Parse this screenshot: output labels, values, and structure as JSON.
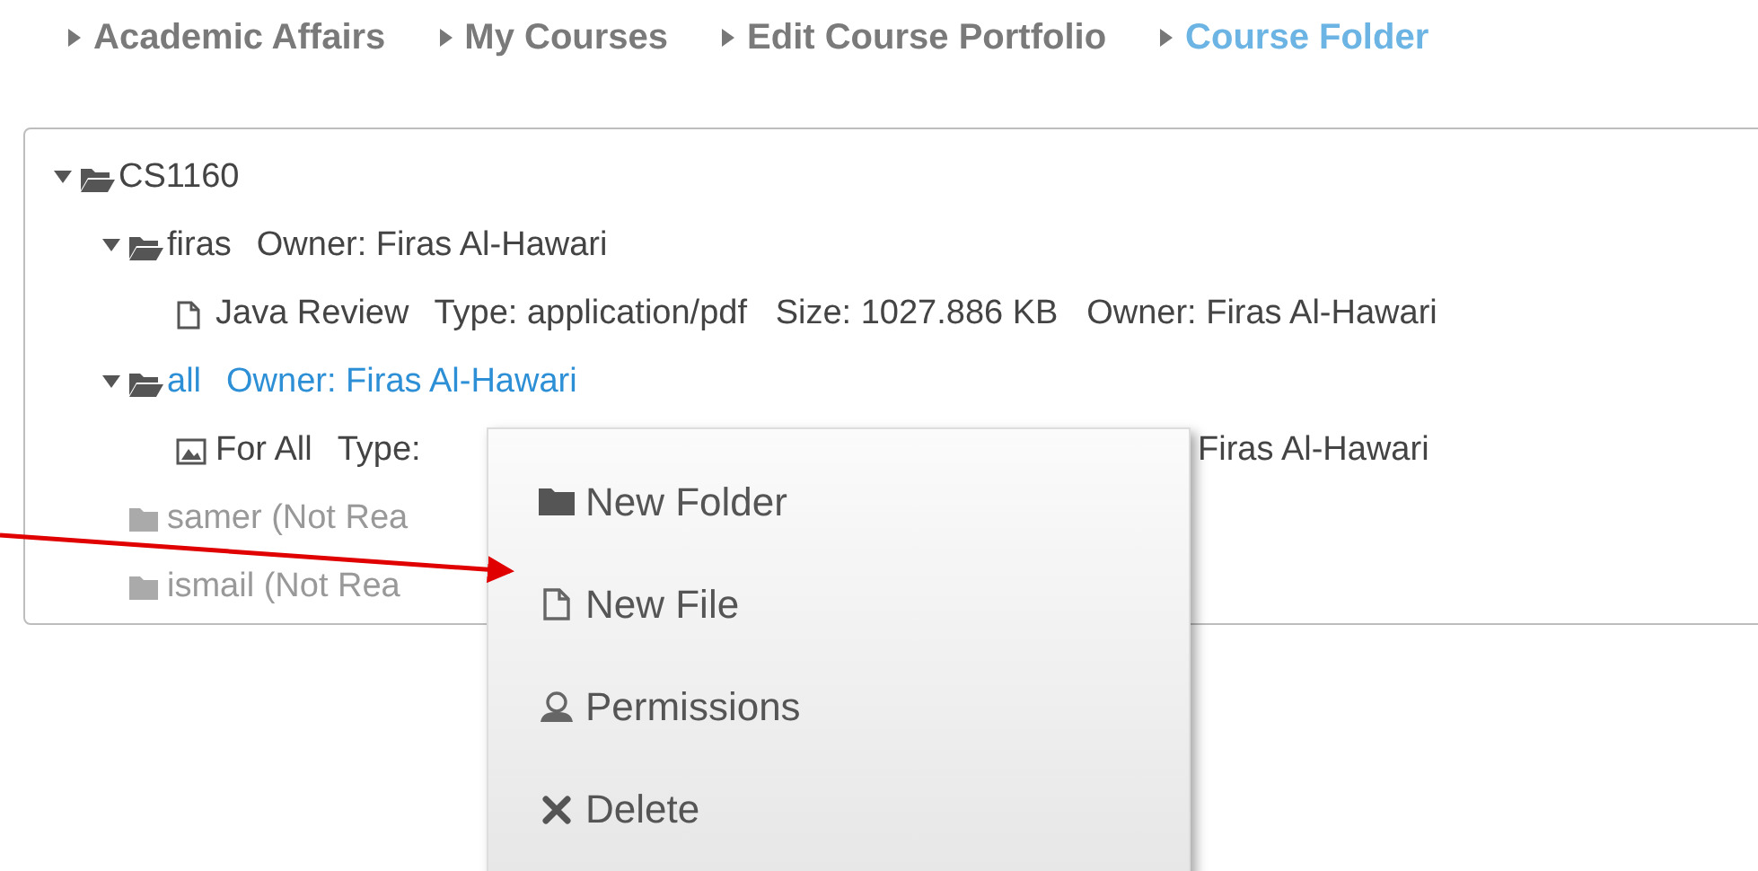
{
  "breadcrumb": [
    {
      "label": "Academic Affairs",
      "selected": false
    },
    {
      "label": "My Courses",
      "selected": false
    },
    {
      "label": "Edit Course Portfolio",
      "selected": false
    },
    {
      "label": "Course Folder",
      "selected": true
    }
  ],
  "tree": {
    "name": "CS1160",
    "kind": "folder",
    "expanded": true,
    "selected": false,
    "disabled": false,
    "children": [
      {
        "name": "firas",
        "kind": "folder",
        "expanded": true,
        "selected": false,
        "disabled": false,
        "details": "Owner: Firas Al-Hawari",
        "children": [
          {
            "name": "Java Review",
            "kind": "file",
            "selected": false,
            "disabled": false,
            "details": "Type: application/pdf   Size: 1027.886 KB   Owner: Firas Al-Hawari"
          }
        ]
      },
      {
        "name": "all",
        "kind": "folder",
        "expanded": true,
        "selected": true,
        "disabled": false,
        "details": "Owner: Firas Al-Hawari",
        "children": [
          {
            "name": "For All",
            "kind": "image",
            "selected": false,
            "disabled": false,
            "details": "Type:",
            "tail": "Firas Al-Hawari"
          }
        ]
      },
      {
        "name": "samer (Not Rea",
        "kind": "folder",
        "selected": false,
        "disabled": true
      },
      {
        "name": "ismail (Not Rea",
        "kind": "folder",
        "selected": false,
        "disabled": true
      }
    ]
  },
  "context_menu": {
    "items": [
      {
        "label": "New Folder",
        "kind": "folder"
      },
      {
        "label": "New File",
        "kind": "file"
      },
      {
        "label": "Permissions",
        "kind": "user"
      },
      {
        "label": "Delete",
        "kind": "delete"
      }
    ]
  }
}
